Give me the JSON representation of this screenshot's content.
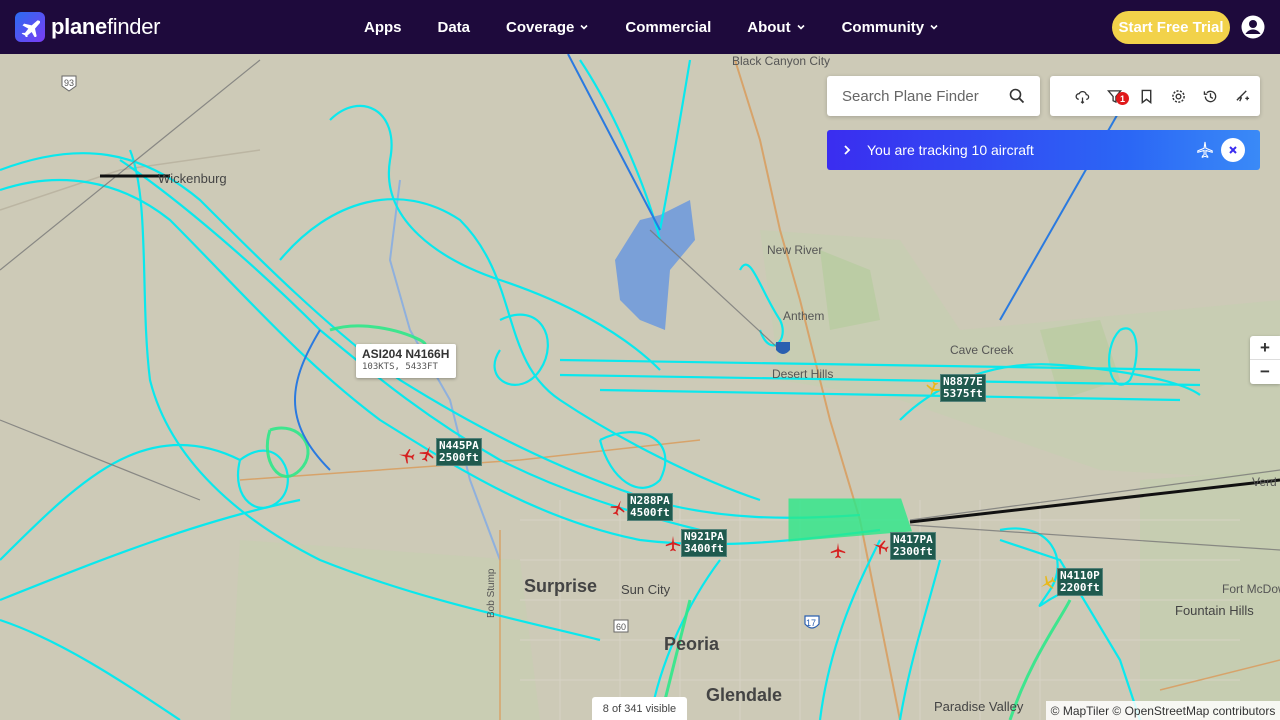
{
  "brand": {
    "name_bold": "plane",
    "name_rest": "finder"
  },
  "nav": {
    "items": [
      {
        "label": "Apps",
        "has_menu": false
      },
      {
        "label": "Data",
        "has_menu": false
      },
      {
        "label": "Coverage",
        "has_menu": true
      },
      {
        "label": "Commercial",
        "has_menu": false
      },
      {
        "label": "About",
        "has_menu": true
      },
      {
        "label": "Community",
        "has_menu": true
      }
    ],
    "cta_label": "Start Free Trial"
  },
  "search": {
    "placeholder": "Search Plane Finder",
    "value": ""
  },
  "toolbar": {
    "buttons": [
      "weather-icon",
      "filter-icon",
      "bookmark-icon",
      "settings-icon",
      "history-icon",
      "airport-icon"
    ],
    "filter_badge": "1"
  },
  "tracking": {
    "text": "You are tracking 10 aircraft"
  },
  "map": {
    "places": {
      "black_canyon_city": "Black Canyon City",
      "wickenburg": "Wickenburg",
      "new_river": "New River",
      "anthem": "Anthem",
      "cave_creek": "Cave Creek",
      "desert_hills": "Desert Hills",
      "surprise": "Surprise",
      "sun_city": "Sun City",
      "peoria": "Peoria",
      "glendale": "Glendale",
      "paradise_valley": "Paradise Valley",
      "fountain_hills": "Fountain Hills",
      "fort_mcdowell": "Fort McDow",
      "verde": "Verd",
      "bob_stump": "Bob Stump"
    },
    "highways": {
      "us93": "93",
      "i17": "17",
      "az60": "60",
      "i17b": "17"
    },
    "selected": {
      "title": "ASI204 N4166H",
      "detail": "103KTS, 5433FT"
    },
    "aircraft": [
      {
        "reg": "N445PA",
        "alt": "2500ft",
        "color": "#d62020"
      },
      {
        "reg": "N288PA",
        "alt": "4500ft",
        "color": "#d62020"
      },
      {
        "reg": "N921PA",
        "alt": "3400ft",
        "color": "#d62020"
      },
      {
        "reg": "N417PA",
        "alt": "2300ft",
        "color": "#d62020"
      },
      {
        "reg": "N8877E",
        "alt": "5375ft",
        "color": "#e8b81a"
      },
      {
        "reg": "N4110P",
        "alt": "2200ft",
        "color": "#e8b81a"
      }
    ],
    "visible_count": "8 of 341 visible",
    "attribution": "© MapTiler © OpenStreetMap contributors"
  },
  "colors": {
    "nav_bg": "#1e0a3c",
    "cta": "#f2d24a",
    "track_main": "#00e8f0",
    "track_alt": "#2ee88a",
    "tracking_bar": "#2b67f5"
  }
}
